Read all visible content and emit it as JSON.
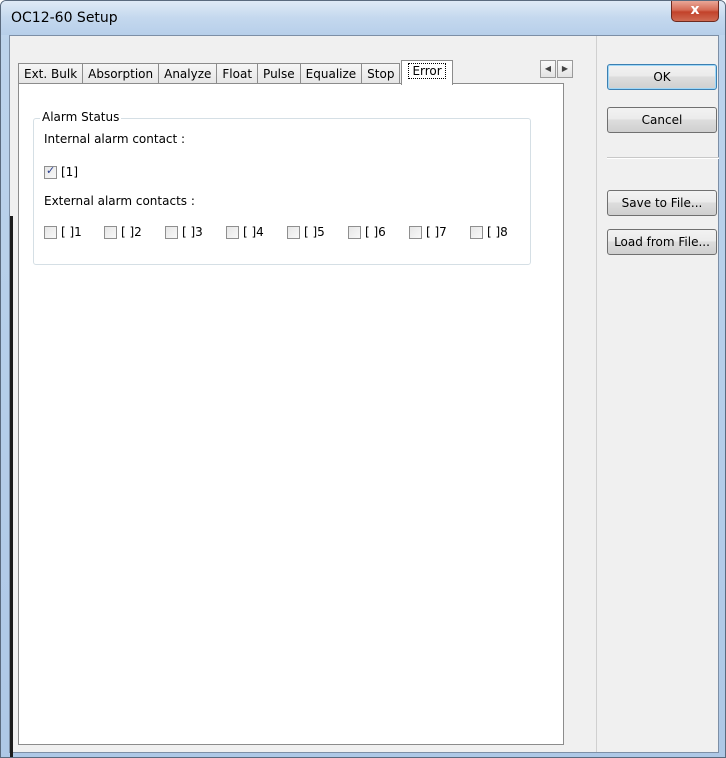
{
  "window": {
    "title": "OC12-60 Setup",
    "close_label": "x"
  },
  "tabs": [
    {
      "label": "Ext. Bulk"
    },
    {
      "label": "Absorption"
    },
    {
      "label": "Analyze"
    },
    {
      "label": "Float"
    },
    {
      "label": "Pulse"
    },
    {
      "label": "Equalize"
    },
    {
      "label": "Stop"
    },
    {
      "label": "Error",
      "selected": true
    }
  ],
  "tab_scroll": {
    "left": "◀",
    "right": "▶"
  },
  "alarm": {
    "group_title": "Alarm Status",
    "internal_label": "Internal alarm contact :",
    "internal": {
      "label": "[1]",
      "checked": true
    },
    "external_label": "External alarm contacts :",
    "external": [
      {
        "label": "[ ]1",
        "checked": false
      },
      {
        "label": "[ ]2",
        "checked": false
      },
      {
        "label": "[ ]3",
        "checked": false
      },
      {
        "label": "[ ]4",
        "checked": false
      },
      {
        "label": "[ ]5",
        "checked": false
      },
      {
        "label": "[ ]6",
        "checked": false
      },
      {
        "label": "[ ]7",
        "checked": false
      },
      {
        "label": "[ ]8",
        "checked": false
      }
    ]
  },
  "buttons": {
    "ok": "OK",
    "cancel": "Cancel",
    "save": "Save to File...",
    "load": "Load from File..."
  }
}
